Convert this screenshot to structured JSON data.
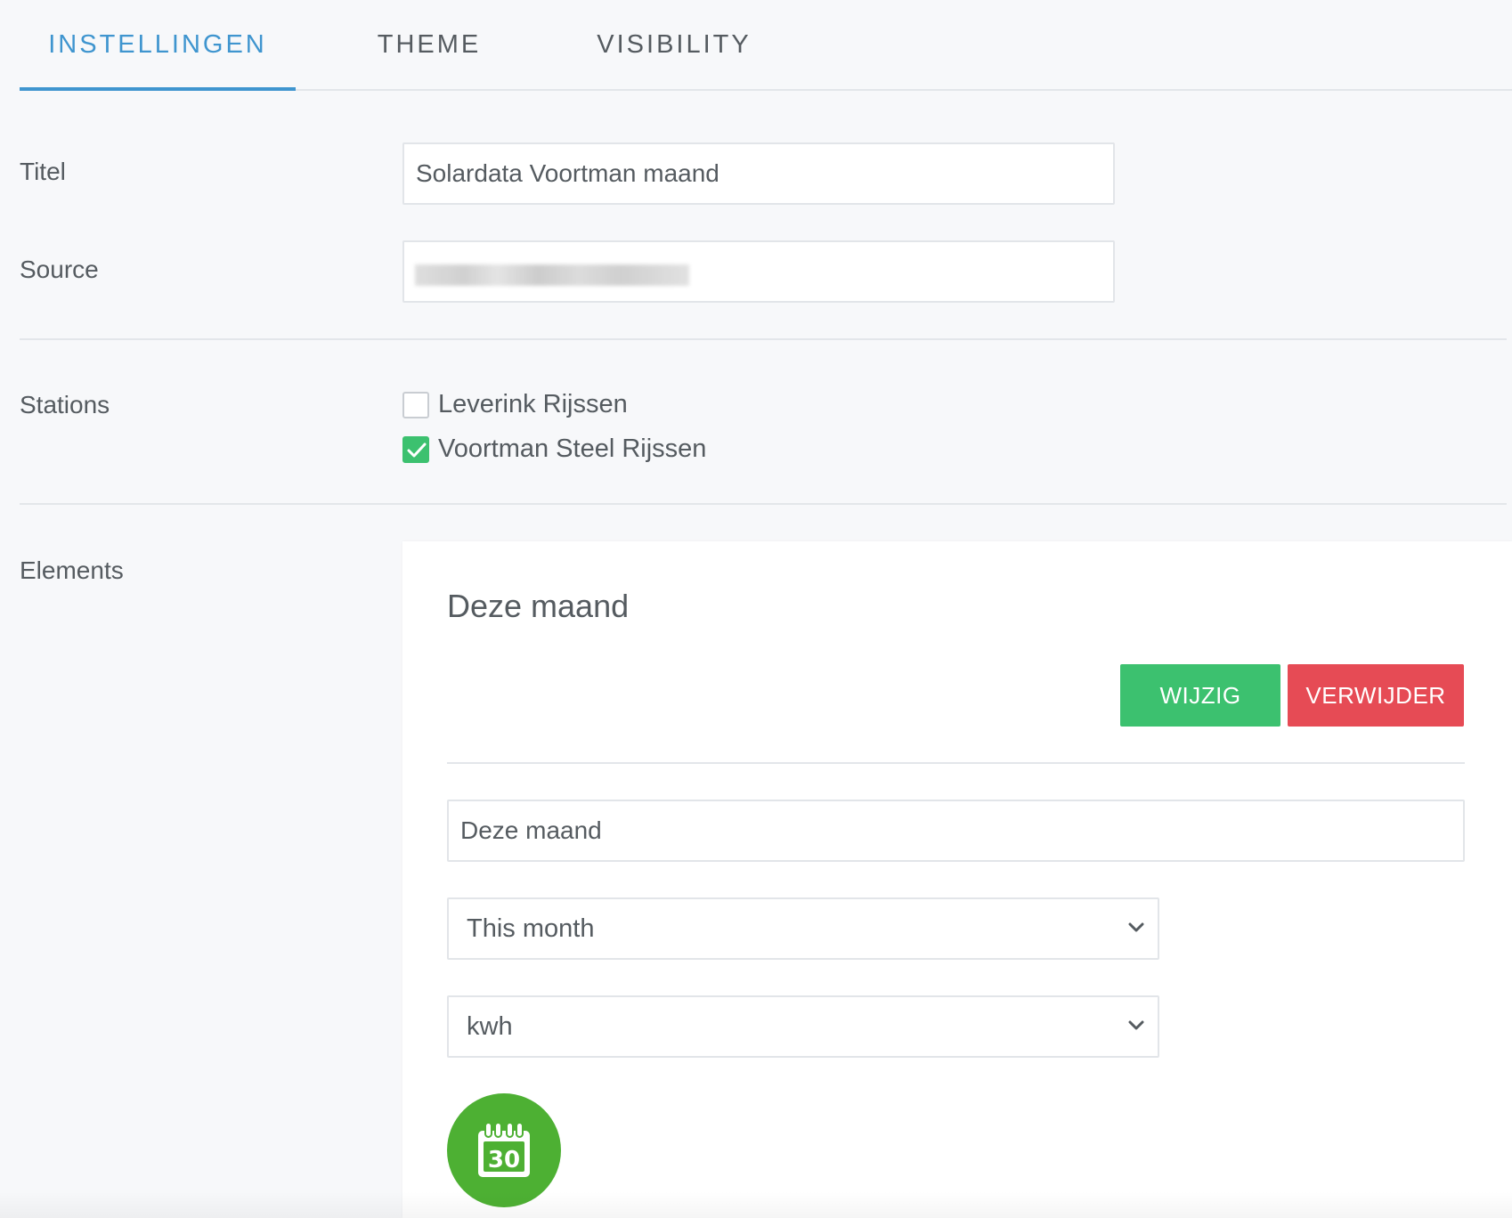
{
  "tabs": [
    {
      "label": "INSTELLINGEN",
      "active": true
    },
    {
      "label": "THEME",
      "active": false
    },
    {
      "label": "VISIBILITY",
      "active": false
    }
  ],
  "form": {
    "title_label": "Titel",
    "title_value": "Solardata Voortman maand",
    "source_label": "Source",
    "stations_label": "Stations",
    "stations": [
      {
        "label": "Leverink Rijssen",
        "checked": false
      },
      {
        "label": "Voortman Steel Rijssen",
        "checked": true
      }
    ],
    "elements_label": "Elements"
  },
  "element_card": {
    "title": "Deze maand",
    "edit_button": "WIJZIG",
    "delete_button": "VERWIJDER",
    "name_value": "Deze maand",
    "period_select": "This month",
    "unit_select": "kwh",
    "icon": "calendar-30-icon",
    "icon_number": "30"
  },
  "colors": {
    "accent": "#3f95cf",
    "success": "#3cc16f",
    "danger": "#e64b55",
    "icon_bg": "#4db033"
  }
}
